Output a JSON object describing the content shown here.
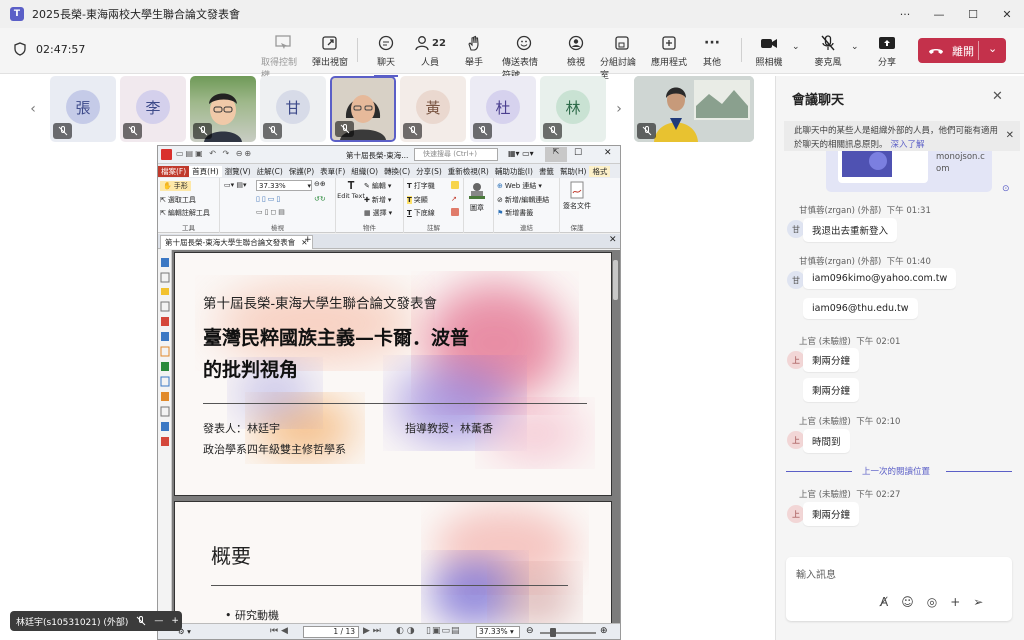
{
  "window": {
    "app_logo": "T",
    "title": "2025長榮-東海兩校大學生聯合論文發表會",
    "controls": [
      "more-icon",
      "minimize-icon",
      "maximize-icon",
      "close-icon"
    ]
  },
  "toolbar": {
    "time": "02:47:57",
    "buttons": {
      "take_control": "取得控制權",
      "pop_out": "彈出視窗",
      "chat": "聊天",
      "people": "人員",
      "people_count": "22",
      "raise_hand": "舉手",
      "reactions": "傳送表情符號",
      "view": "檢視",
      "rooms": "分組討論室",
      "apps": "應用程式",
      "more": "其他",
      "camera": "照相機",
      "mic": "麥克風",
      "share": "分享"
    },
    "leave": "離開",
    "colors": {
      "accent": "#5b5fc7",
      "leave": "#c4314b"
    }
  },
  "gallery": {
    "participants": [
      {
        "initial": "張",
        "type": "avatar"
      },
      {
        "initial": "李",
        "type": "avatar"
      },
      {
        "initial": "",
        "type": "video"
      },
      {
        "initial": "甘",
        "type": "avatar"
      },
      {
        "initial": "",
        "type": "video"
      },
      {
        "initial": "黃",
        "type": "avatar"
      },
      {
        "initial": "杜",
        "type": "avatar"
      },
      {
        "initial": "林",
        "type": "avatar"
      }
    ]
  },
  "pdf_viewer": {
    "window_title": "第十屆長榮-東海...",
    "search_placeholder": "快速搜尋 (Ctrl+)",
    "ribbon_tabs": [
      "檔案(F)",
      "首頁(H)",
      "瀏覽(V)",
      "註解(C)",
      "保護(P)",
      "表單(F)",
      "組織(O)",
      "轉換(C)",
      "分享(S)",
      "重新檢視(R)",
      "輔助功能(I)",
      "書籤",
      "幫助(H)",
      "格式"
    ],
    "ribbon": {
      "hand": "手形",
      "select_tool": "選取工具",
      "edit_annotation_tool": "編輯註解工具",
      "group_tools": "工具",
      "zoom": "37.33%",
      "group_view": "檢視",
      "edit_text": "Edit Text",
      "edit": "編輯",
      "new": "新增",
      "select": "選擇",
      "group_object": "物件",
      "typewriter": "打字機",
      "highlight": "突顯",
      "underline": "下底線",
      "group_annotation": "註解",
      "stamp": "圖章",
      "web_link": "Web 連結",
      "new_edit_link": "新增/編輯連結",
      "new_bookmark": "新增書籤",
      "group_link": "連結",
      "sign": "簽名文件",
      "group_protect": "保護"
    },
    "doc_tab": "第十屆長榮-東海大學生聯合論文發表會",
    "slide1": {
      "event": "第十屆長榮-東海大學生聯合論文發表會",
      "title_line1": "臺灣民粹國族主義—卡爾．波普",
      "title_line2": "的批判視角",
      "presenter": "發表人：林廷宇",
      "advisor": "指導教授：林薰香",
      "department": "政治學系四年級雙主修哲學系"
    },
    "slide2": {
      "title": "概要",
      "bullet1": "研究動機"
    },
    "status": {
      "page": "1 / 13",
      "zoom": "37.33%"
    }
  },
  "chat": {
    "title": "會議聊天",
    "banner": "此聊天中的某些人是組織外部的人員，他們可能有適用於聊天的相關訊息原則。",
    "banner_link": "深入了解",
    "card_domain": "monojson.com",
    "messages": [
      {
        "author": "甘慎蓉(zrgan) (外部)",
        "time": "下午 01:31",
        "initial": "甘",
        "texts": [
          "我退出去重新登入"
        ]
      },
      {
        "author": "甘慎蓉(zrgan) (外部)",
        "time": "下午 01:40",
        "initial": "甘",
        "texts": [
          "iam096kimo@yahoo.com.tw",
          "iam096@thu.edu.tw"
        ]
      },
      {
        "author": "上官 (未驗證)",
        "time": "下午 02:01",
        "initial": "上",
        "texts": [
          "剩兩分鐘",
          "剩兩分鐘"
        ]
      },
      {
        "author": "上官 (未驗證)",
        "time": "下午 02:10",
        "initial": "上",
        "texts": [
          "時間到"
        ]
      },
      {
        "author": "上官 (未驗證)",
        "time": "下午 02:27",
        "initial": "上",
        "texts": [
          "剩兩分鐘"
        ]
      }
    ],
    "last_read": "上一次的閱讀位置",
    "compose_placeholder": "輸入訊息"
  },
  "self_view": {
    "name": "林廷宇(s10531021) (外部)"
  }
}
